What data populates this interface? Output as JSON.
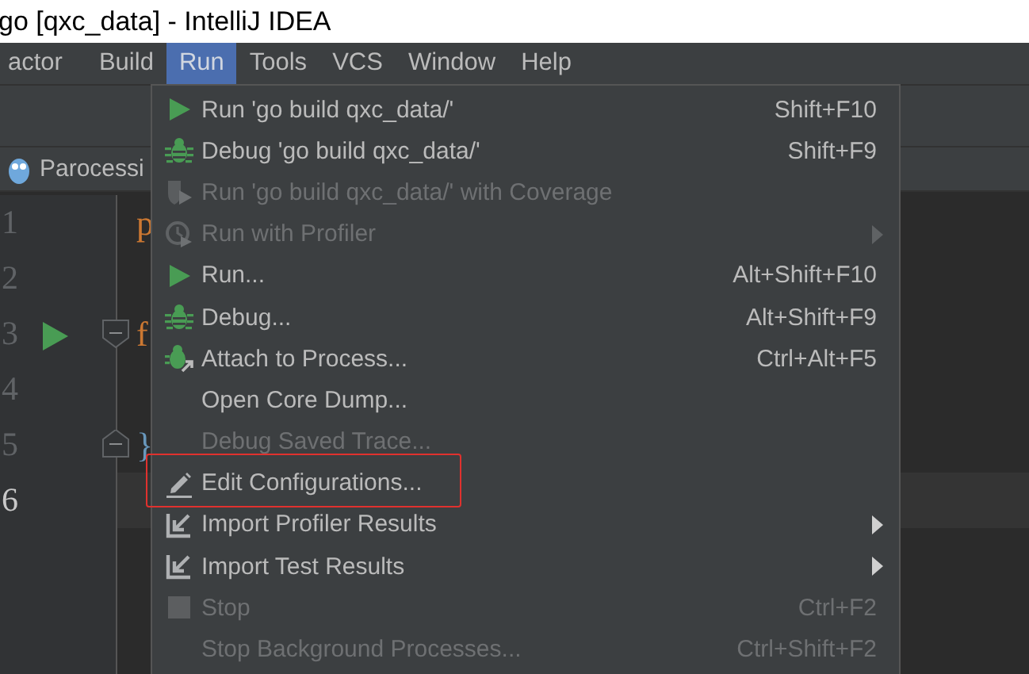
{
  "window": {
    "title": "go [qxc_data] - IntelliJ IDEA"
  },
  "menubar": [
    {
      "label": "actor",
      "selected": false
    },
    {
      "label": "Build",
      "selected": false
    },
    {
      "label": "Run",
      "selected": true
    },
    {
      "label": "Tools",
      "selected": false
    },
    {
      "label": "VCS",
      "selected": false
    },
    {
      "label": "Window",
      "selected": false
    },
    {
      "label": "Help",
      "selected": false
    }
  ],
  "editor_tab": {
    "label": "Parocessi"
  },
  "editor": {
    "lines": [
      {
        "number": "1",
        "code": "p",
        "color": "#cc7832",
        "current": false,
        "run_marker": false,
        "kind": "plain"
      },
      {
        "number": "2",
        "current": false,
        "run_marker": false,
        "kind": "plain"
      },
      {
        "number": "3",
        "code": "f",
        "color": "#cc7832",
        "current": false,
        "run_marker": true,
        "kind": "fold_start"
      },
      {
        "number": "4",
        "current": false,
        "run_marker": false,
        "kind": "plain"
      },
      {
        "number": "5",
        "code": "}",
        "color": "#6897bb",
        "current": false,
        "run_marker": false,
        "kind": "fold_end"
      },
      {
        "number": "6",
        "current": true,
        "run_marker": false,
        "kind": "plain"
      }
    ]
  },
  "run_menu": {
    "items": [
      {
        "label": "Run 'go build qxc_data/'",
        "shortcut": "Shift+F10",
        "kind": "run",
        "disabled": false,
        "submenu": false,
        "highlighted": false
      },
      {
        "label": "Debug 'go build qxc_data/'",
        "shortcut": "Shift+F9",
        "kind": "debug",
        "disabled": false,
        "submenu": false,
        "highlighted": false
      },
      {
        "label": "Run 'go build qxc_data/' with Coverage",
        "kind": "coverage",
        "disabled": true,
        "submenu": false,
        "highlighted": false
      },
      {
        "label": "Run with Profiler",
        "kind": "profiler",
        "disabled": true,
        "submenu": true,
        "highlighted": false
      },
      {
        "label": "Run...",
        "shortcut": "Alt+Shift+F10",
        "kind": "run",
        "disabled": false,
        "submenu": false,
        "highlighted": false
      },
      {
        "label": "Debug...",
        "shortcut": "Alt+Shift+F9",
        "kind": "debug",
        "disabled": false,
        "submenu": false,
        "highlighted": false
      },
      {
        "label": "Attach to Process...",
        "shortcut": "Ctrl+Alt+F5",
        "kind": "attach",
        "disabled": false,
        "submenu": false,
        "highlighted": false
      },
      {
        "label": "Open Core Dump...",
        "kind": "plain",
        "disabled": false,
        "submenu": false,
        "highlighted": false
      },
      {
        "label": "Debug Saved Trace...",
        "kind": "plain",
        "disabled": true,
        "submenu": false,
        "highlighted": false
      },
      {
        "label": "Edit Configurations...",
        "kind": "edit",
        "disabled": false,
        "submenu": false,
        "highlighted": true
      },
      {
        "label": "Import Profiler Results",
        "kind": "import",
        "disabled": false,
        "submenu": true,
        "highlighted": false
      },
      {
        "label": "Import Test Results",
        "kind": "import",
        "disabled": false,
        "submenu": true,
        "highlighted": false
      },
      {
        "label": "Stop",
        "shortcut": "Ctrl+F2",
        "kind": "stop",
        "disabled": true,
        "submenu": false,
        "highlighted": false
      },
      {
        "label": "Stop Background Processes...",
        "shortcut": "Ctrl+Shift+F2",
        "kind": "plain",
        "disabled": true,
        "submenu": false,
        "highlighted": false
      }
    ]
  }
}
